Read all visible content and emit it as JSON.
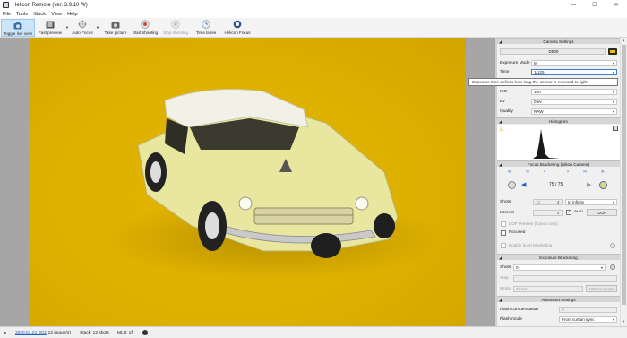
{
  "window": {
    "title": "Helicon Remote (ver. 3.9.10 W)",
    "minimize": "—",
    "maximize": "☐",
    "close": "✕"
  },
  "menu": [
    "File",
    "Tools",
    "Stack",
    "View",
    "Help"
  ],
  "toolbar": {
    "toggle_live_view": "Toggle live view",
    "fast_preview": "Fast preview",
    "auto_focus": "Auto Focus",
    "take_picture": "Take picture",
    "start_shooting": "Start shooting",
    "stop_shooting": "Stop shooting",
    "time_lapse": "Time lapse",
    "helicon_focus": "Helicon Focus"
  },
  "tooltip": "Exposure time defines how long the sensor is exposed to light.",
  "camera_settings": {
    "header": "Camera Settings",
    "camera_model": "D800",
    "exposure_mode_label": "Exposure Mode",
    "exposure_mode_value": "M",
    "time_label": "Time",
    "time_value": "1/125",
    "iso_label": "ISO",
    "iso_value": "100",
    "ev_label": "Ev",
    "ev_value": "0 ev",
    "quality_label": "Quality",
    "quality_value": "RAW"
  },
  "histogram": {
    "header": "Histogram"
  },
  "focus_bracketing": {
    "header": "Focus Bracketing (Nikon Camera)",
    "position": "75 / 75",
    "shots_label": "Shots",
    "shots_value": "12",
    "to_infinity": "to infinity",
    "interval_label": "Interval",
    "interval_value": "7",
    "auto_label": "Auto",
    "dof_button": "DOF",
    "dof_preview": "DOF Preview (Canon only)",
    "focused": "Focused",
    "burst": "Enable burst bracketing"
  },
  "exposure_bracketing": {
    "header": "Exposure Bracketing",
    "shots_label": "Shots",
    "shots_value": "0",
    "step_label": "Step",
    "mode_label": "Mode",
    "mode_value": "Smart",
    "manual_mode": "Manual mode"
  },
  "advanced_settings": {
    "header": "Advanced Settings",
    "flash_comp_label": "Flash compensation",
    "flash_comp_value": "0",
    "flash_mode_label": "Flash mode",
    "flash_mode_value": "Front curtain sync"
  },
  "status": {
    "folder_link": "2020.04.24_001",
    "images": ": 12 image(s)",
    "stack": "Stack: 12 shots",
    "mlu": "MLU: off"
  },
  "colors": {
    "photo_background": "#ddb000",
    "active_tool": "#cce4f7",
    "link": "#1f5fbf"
  }
}
